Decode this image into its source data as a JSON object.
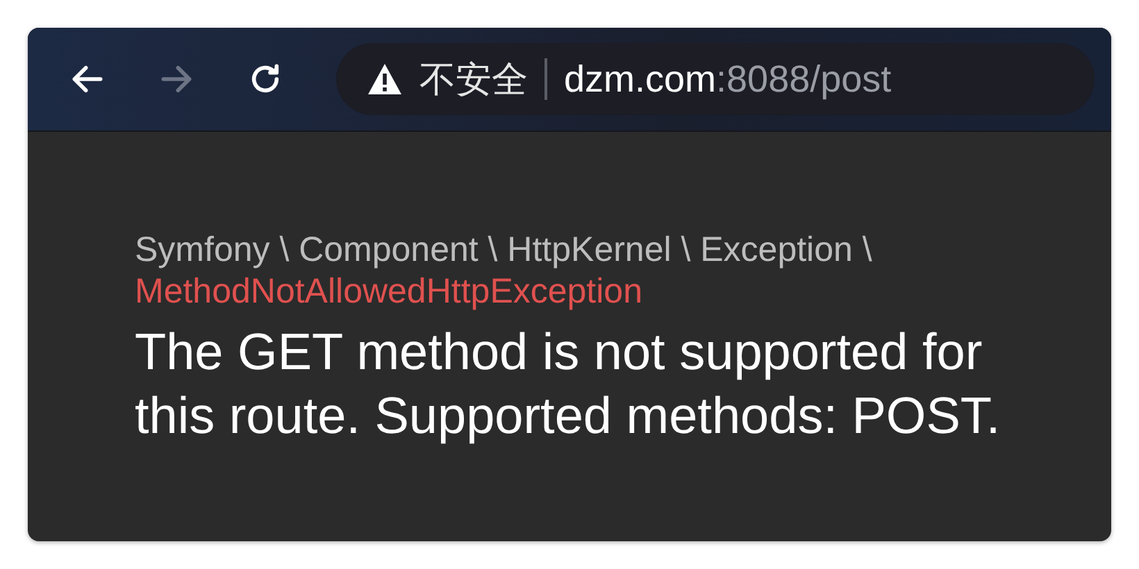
{
  "toolbar": {
    "buttons": [
      {
        "kind": "back",
        "disabled": false
      },
      {
        "kind": "forward",
        "disabled": true
      },
      {
        "kind": "reload",
        "disabled": false
      }
    ],
    "address": {
      "security_label": "不安全",
      "host": "dzm.com",
      "rest": ":8088/post"
    }
  },
  "error": {
    "namespace": "Symfony \\ Component \\ HttpKernel \\ Exception \\",
    "class_name": "MethodNotAllowedHttpException",
    "message": "The GET method is not supported for this route. Supported methods: POST."
  }
}
